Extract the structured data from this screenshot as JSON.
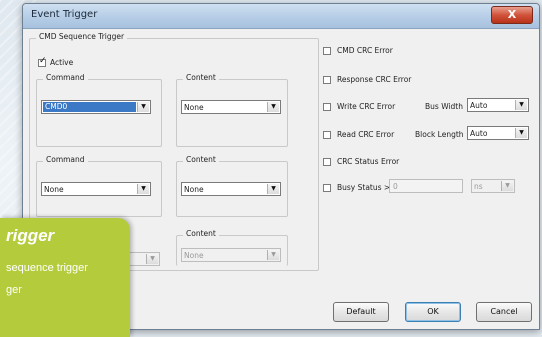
{
  "window": {
    "title": "Event Trigger",
    "close_label": "X"
  },
  "cmd_group": {
    "label": "CMD Sequence Trigger",
    "active_label": "Active",
    "active_checked": true,
    "row1": {
      "command_label": "Command",
      "command_value": "CMD0",
      "content_label": "Content",
      "content_value": "None"
    },
    "row2": {
      "command_label": "Command",
      "command_value": "None",
      "content_label": "Content",
      "content_value": "None"
    },
    "row3": {
      "command_value": "",
      "content_label": "Content",
      "content_value": "None"
    }
  },
  "options": {
    "cmd_crc_error": "CMD CRC Error",
    "response_crc_error": "Response CRC Error",
    "write_crc_error": "Write CRC Error",
    "read_crc_error": "Read CRC Error",
    "crc_status_error": "CRC Status Error",
    "busy_status": "Busy Status >=",
    "bus_width_label": "Bus Width",
    "bus_width_value": "Auto",
    "block_length_label": "Block Length",
    "block_length_value": "Auto",
    "busy_value": "0",
    "busy_unit": "ns"
  },
  "buttons": {
    "default": "Default",
    "ok": "OK",
    "cancel": "Cancel"
  },
  "callout": {
    "title": "rigger",
    "line1": "sequence trigger",
    "line2": "ger"
  }
}
